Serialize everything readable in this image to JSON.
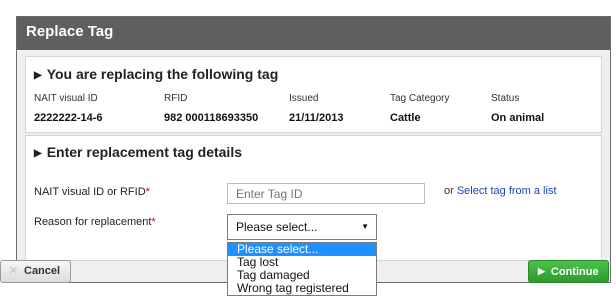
{
  "dialog": {
    "title": "Replace Tag"
  },
  "current_tag": {
    "section_title": "You are replacing the following tag",
    "columns": [
      "NAIT visual ID",
      "RFID",
      "Issued",
      "Tag Category",
      "Status"
    ],
    "values": [
      "2222222-14-6",
      "982 000118693350",
      "21/11/2013",
      "Cattle",
      "On animal"
    ]
  },
  "replacement": {
    "section_title": "Enter replacement tag details",
    "id_label": "NAIT visual ID or RFID",
    "required_mark": "*",
    "id_placeholder": "Enter Tag ID",
    "or_text": "or",
    "select_link": "Select tag from a list",
    "reason_label": "Reason for replacement",
    "reason_selected": "Please select...",
    "reason_options": [
      "Please select...",
      "Tag lost",
      "Tag damaged",
      "Wrong tag registered"
    ]
  },
  "buttons": {
    "cancel": "Cancel",
    "continue": "Continue"
  },
  "colors": {
    "titlebar": "#5f5f5f",
    "continue": "#3aaa38",
    "link": "#1f3fbf",
    "required": "#dd0000",
    "option_highlight": "#1e90ff"
  }
}
